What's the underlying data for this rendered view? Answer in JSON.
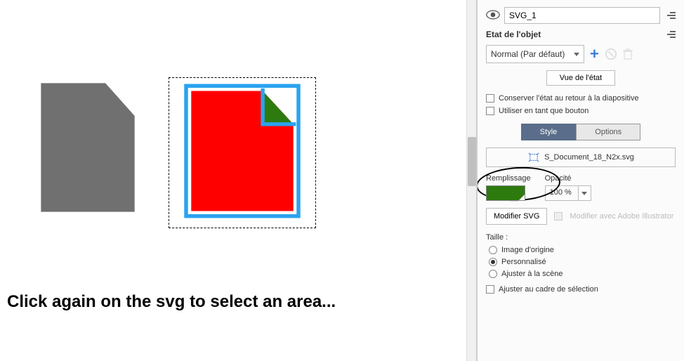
{
  "canvas": {
    "instruction": "Click again on the svg to select an area..."
  },
  "panel": {
    "object_name": "SVG_1",
    "state_section_title": "Etat de l'objet",
    "state_selector": "Normal (Par défaut)",
    "view_state_btn": "Vue de l'état",
    "checkbox_keep_state": "Conserver l'état au retour à la diapositive",
    "checkbox_as_button": "Utiliser en tant que bouton",
    "tab_style": "Style",
    "tab_options": "Options",
    "filename": "S_Document_18_N2x.svg",
    "fill_label": "Remplissage",
    "fill_color": "#2d7a0f",
    "opacity_label": "Opacité",
    "opacity_value": "100 %",
    "modify_svg_btn": "Modifier SVG",
    "modify_illustrator": "Modifier avec Adobe Illustrator",
    "size_label": "Taille :",
    "size_opt_original": "Image d'origine",
    "size_opt_custom": "Personnalisé",
    "size_opt_fit": "Ajuster à la scène",
    "fit_selection": "Ajuster au cadre de sélection"
  }
}
